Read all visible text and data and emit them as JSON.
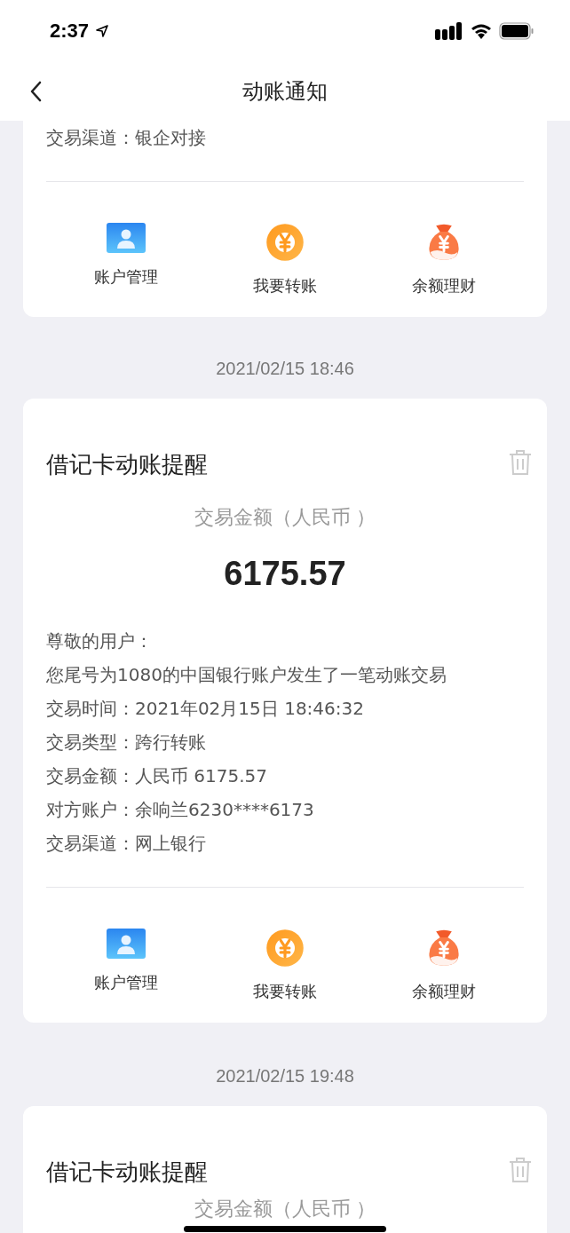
{
  "status_bar": {
    "time": "2:37"
  },
  "nav": {
    "title": "动账通知"
  },
  "cards": [
    {
      "lines": [
        "交易渠道：银企对接"
      ],
      "actions": [
        {
          "kind": "account",
          "label": "账户管理"
        },
        {
          "kind": "transfer",
          "label": "我要转账"
        },
        {
          "kind": "wealth",
          "label": "余额理财"
        }
      ]
    },
    {
      "date": "2021/02/15 18:46",
      "title": "借记卡动账提醒",
      "amount_label": "交易金额（人民币 ）",
      "amount": "6175.57",
      "lines": [
        "尊敬的用户：",
        "您尾号为1080的中国银行账户发生了一笔动账交易",
        "交易时间：2021年02月15日 18:46:32",
        "交易类型：跨行转账",
        "交易金额：人民币 6175.57",
        "对方账户：余响兰6230****6173",
        "交易渠道：网上银行"
      ],
      "actions": [
        {
          "kind": "account",
          "label": "账户管理"
        },
        {
          "kind": "transfer",
          "label": "我要转账"
        },
        {
          "kind": "wealth",
          "label": "余额理财"
        }
      ]
    },
    {
      "date": "2021/02/15 19:48",
      "title": "借记卡动账提醒",
      "amount_label": "交易金额（人民币 ）"
    }
  ]
}
